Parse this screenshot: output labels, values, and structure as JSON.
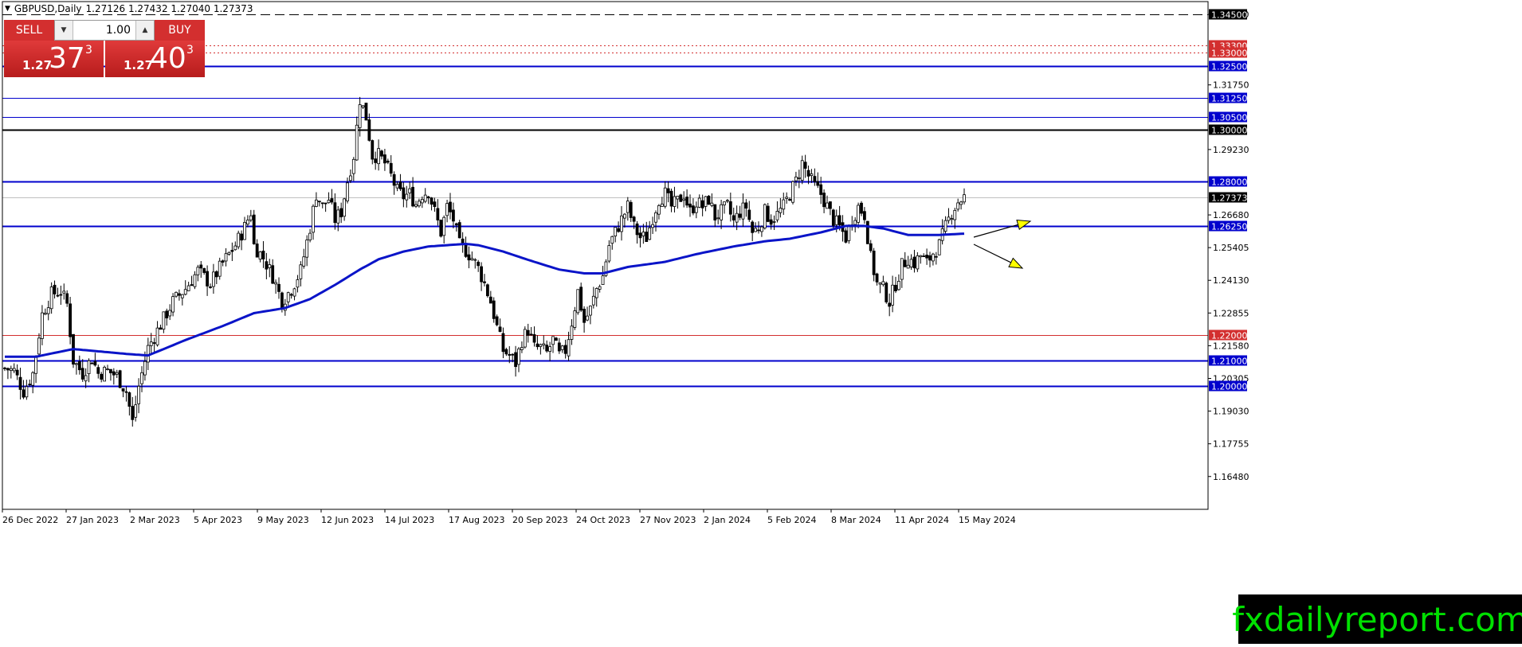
{
  "window": {
    "symbol_title": "GBPUSD,Daily",
    "ohlc": "1.27126 1.27432 1.27040 1.27373"
  },
  "trade_panel": {
    "sell_label": "SELL",
    "buy_label": "BUY",
    "lot": "1.00",
    "sell_prefix": "1.27",
    "sell_big": "37",
    "sell_sup": "3",
    "buy_prefix": "1.27",
    "buy_big": "40",
    "buy_sup": "3"
  },
  "logo": {
    "text": "fxdailyreport.com"
  },
  "colors": {
    "blue_level": "#0000cd",
    "red_level": "#d32f2f",
    "ma": "#0a14c8",
    "arrow": "#ffff00"
  },
  "chart_data": {
    "type": "candlestick",
    "ylim": [
      1.152,
      1.3475
    ],
    "y_ticks": [
      "1.34500",
      "1.31750",
      "1.29230",
      "1.26680",
      "1.25405",
      "1.24130",
      "1.22855",
      "1.21580",
      "1.20305",
      "1.19030",
      "1.17755",
      "1.16480"
    ],
    "x_labels": [
      "26 Dec 2022",
      "27 Jan 2023",
      "2 Mar 2023",
      "5 Apr 2023",
      "9 May 2023",
      "12 Jun 2023",
      "14 Jul 2023",
      "17 Aug 2023",
      "20 Sep 2023",
      "24 Oct 2023",
      "27 Nov 2023",
      "2 Jan 2024",
      "5 Feb 2024",
      "8 Mar 2024",
      "11 Apr 2024",
      "15 May 2024"
    ],
    "levels": [
      {
        "price": 1.345,
        "label": "1.34500",
        "style": "dash-black"
      },
      {
        "price": 1.333,
        "label": "1.33300",
        "style": "dot-red"
      },
      {
        "price": 1.33,
        "label": "1.33000",
        "style": "dot-red"
      },
      {
        "price": 1.325,
        "label": "1.32500",
        "style": "solid-blue-thick"
      },
      {
        "price": 1.3125,
        "label": "1.31250",
        "style": "solid-blue"
      },
      {
        "price": 1.305,
        "label": "1.30500",
        "style": "solid-blue"
      },
      {
        "price": 1.3,
        "label": "1.30000",
        "style": "solid-black"
      },
      {
        "price": 1.28,
        "label": "1.28000",
        "style": "solid-blue-thick"
      },
      {
        "price": 1.27373,
        "label": "1.27373",
        "style": "current"
      },
      {
        "price": 1.2625,
        "label": "1.26250",
        "style": "solid-blue-thick"
      },
      {
        "price": 1.22,
        "label": "1.22000",
        "style": "solid-red"
      },
      {
        "price": 1.21,
        "label": "1.21000",
        "style": "solid-blue-thick"
      },
      {
        "price": 1.2,
        "label": "1.20000",
        "style": "solid-blue-thick"
      }
    ],
    "close_path": [
      [
        0,
        1.207
      ],
      [
        3,
        1.206
      ],
      [
        6,
        1.198
      ],
      [
        9,
        1.205
      ],
      [
        12,
        1.228
      ],
      [
        15,
        1.236
      ],
      [
        18,
        1.237
      ],
      [
        20,
        1.232
      ],
      [
        22,
        1.21
      ],
      [
        25,
        1.205
      ],
      [
        28,
        1.211
      ],
      [
        30,
        1.205
      ],
      [
        33,
        1.206
      ],
      [
        36,
        1.204
      ],
      [
        39,
        1.198
      ],
      [
        41,
        1.186
      ],
      [
        43,
        1.2
      ],
      [
        46,
        1.215
      ],
      [
        50,
        1.224
      ],
      [
        54,
        1.233
      ],
      [
        58,
        1.238
      ],
      [
        62,
        1.245
      ],
      [
        66,
        1.24
      ],
      [
        70,
        1.248
      ],
      [
        74,
        1.255
      ],
      [
        77,
        1.262
      ],
      [
        79,
        1.268
      ],
      [
        80,
        1.255
      ],
      [
        83,
        1.25
      ],
      [
        86,
        1.243
      ],
      [
        89,
        1.233
      ],
      [
        92,
        1.238
      ],
      [
        95,
        1.245
      ],
      [
        98,
        1.262
      ],
      [
        100,
        1.275
      ],
      [
        102,
        1.27
      ],
      [
        104,
        1.273
      ],
      [
        106,
        1.265
      ],
      [
        108,
        1.268
      ],
      [
        110,
        1.28
      ],
      [
        112,
        1.29
      ],
      [
        114,
        1.312
      ],
      [
        116,
        1.305
      ],
      [
        118,
        1.29
      ],
      [
        120,
        1.29
      ],
      [
        122,
        1.287
      ],
      [
        124,
        1.282
      ],
      [
        126,
        1.276
      ],
      [
        128,
        1.274
      ],
      [
        130,
        1.275
      ],
      [
        132,
        1.271
      ],
      [
        134,
        1.275
      ],
      [
        136,
        1.276
      ],
      [
        138,
        1.268
      ],
      [
        140,
        1.26
      ],
      [
        142,
        1.27
      ],
      [
        144,
        1.265
      ],
      [
        146,
        1.255
      ],
      [
        148,
        1.253
      ],
      [
        150,
        1.25
      ],
      [
        152,
        1.246
      ],
      [
        154,
        1.24
      ],
      [
        156,
        1.233
      ],
      [
        158,
        1.223
      ],
      [
        160,
        1.214
      ],
      [
        162,
        1.212
      ],
      [
        164,
        1.209
      ],
      [
        166,
        1.218
      ],
      [
        168,
        1.222
      ],
      [
        170,
        1.215
      ],
      [
        172,
        1.215
      ],
      [
        174,
        1.213
      ],
      [
        176,
        1.218
      ],
      [
        178,
        1.212
      ],
      [
        180,
        1.214
      ],
      [
        182,
        1.225
      ],
      [
        184,
        1.237
      ],
      [
        186,
        1.225
      ],
      [
        188,
        1.23
      ],
      [
        190,
        1.238
      ],
      [
        192,
        1.243
      ],
      [
        194,
        1.255
      ],
      [
        196,
        1.26
      ],
      [
        198,
        1.265
      ],
      [
        200,
        1.27
      ],
      [
        202,
        1.262
      ],
      [
        204,
        1.258
      ],
      [
        206,
        1.258
      ],
      [
        208,
        1.266
      ],
      [
        210,
        1.273
      ],
      [
        212,
        1.275
      ],
      [
        214,
        1.27
      ],
      [
        216,
        1.272
      ],
      [
        218,
        1.275
      ],
      [
        220,
        1.268
      ],
      [
        222,
        1.272
      ],
      [
        224,
        1.27
      ],
      [
        226,
        1.273
      ],
      [
        228,
        1.266
      ],
      [
        230,
        1.268
      ],
      [
        232,
        1.27
      ],
      [
        234,
        1.264
      ],
      [
        236,
        1.268
      ],
      [
        238,
        1.27
      ],
      [
        240,
        1.26
      ],
      [
        242,
        1.262
      ],
      [
        244,
        1.268
      ],
      [
        246,
        1.265
      ],
      [
        248,
        1.267
      ],
      [
        250,
        1.27
      ],
      [
        252,
        1.275
      ],
      [
        254,
        1.28
      ],
      [
        256,
        1.287
      ],
      [
        258,
        1.282
      ],
      [
        260,
        1.278
      ],
      [
        262,
        1.275
      ],
      [
        264,
        1.27
      ],
      [
        266,
        1.265
      ],
      [
        268,
        1.262
      ],
      [
        270,
        1.258
      ],
      [
        272,
        1.265
      ],
      [
        274,
        1.27
      ],
      [
        276,
        1.267
      ],
      [
        278,
        1.25
      ],
      [
        280,
        1.24
      ],
      [
        282,
        1.238
      ],
      [
        284,
        1.233
      ],
      [
        286,
        1.24
      ],
      [
        288,
        1.247
      ],
      [
        290,
        1.25
      ],
      [
        292,
        1.248
      ],
      [
        294,
        1.251
      ],
      [
        296,
        1.248
      ],
      [
        298,
        1.252
      ],
      [
        300,
        1.255
      ],
      [
        302,
        1.262
      ],
      [
        304,
        1.268
      ],
      [
        306,
        1.272
      ],
      [
        308,
        1.2737
      ]
    ],
    "ma_path": [
      [
        0,
        1.2115
      ],
      [
        10,
        1.2115
      ],
      [
        22,
        1.2145
      ],
      [
        40,
        1.2125
      ],
      [
        46,
        1.212
      ],
      [
        58,
        1.218
      ],
      [
        70,
        1.2235
      ],
      [
        80,
        1.2285
      ],
      [
        90,
        1.2305
      ],
      [
        98,
        1.234
      ],
      [
        106,
        1.2395
      ],
      [
        114,
        1.2455
      ],
      [
        120,
        1.2495
      ],
      [
        128,
        1.2525
      ],
      [
        136,
        1.2545
      ],
      [
        148,
        1.2555
      ],
      [
        152,
        1.255
      ],
      [
        160,
        1.2525
      ],
      [
        170,
        1.2485
      ],
      [
        178,
        1.2455
      ],
      [
        186,
        1.244
      ],
      [
        192,
        1.244
      ],
      [
        200,
        1.2465
      ],
      [
        212,
        1.2485
      ],
      [
        222,
        1.2515
      ],
      [
        234,
        1.2545
      ],
      [
        244,
        1.2565
      ],
      [
        252,
        1.2575
      ],
      [
        262,
        1.26
      ],
      [
        270,
        1.2625
      ],
      [
        276,
        1.2625
      ],
      [
        282,
        1.2615
      ],
      [
        290,
        1.259
      ],
      [
        300,
        1.259
      ],
      [
        308,
        1.2595
      ]
    ]
  }
}
